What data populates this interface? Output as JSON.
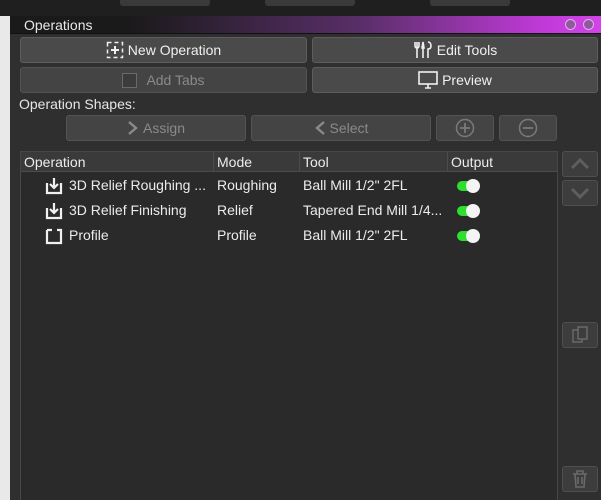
{
  "panel": {
    "title": "Operations"
  },
  "toolbar": {
    "new_operation": "New Operation",
    "edit_tools": "Edit Tools",
    "add_tabs": "Add Tabs",
    "preview": "Preview"
  },
  "shapes": {
    "label": "Operation Shapes:",
    "assign": "Assign",
    "select": "Select"
  },
  "table": {
    "headers": {
      "operation": "Operation",
      "mode": "Mode",
      "tool": "Tool",
      "output": "Output"
    },
    "rows": [
      {
        "operation": "3D Relief Roughing ...",
        "mode": "Roughing",
        "tool": "Ball Mill 1/2\" 2FL",
        "icon": "relief-icon",
        "output": true
      },
      {
        "operation": "3D Relief Finishing",
        "mode": "Relief",
        "tool": "Tapered End Mill 1/4...",
        "icon": "relief-icon",
        "output": true
      },
      {
        "operation": "Profile",
        "mode": "Profile",
        "tool": "Ball Mill 1/2\" 2FL",
        "icon": "profile-icon",
        "output": true
      }
    ]
  },
  "colors": {
    "toggle_on": "#2ee02e",
    "title_accent": "#d244e8"
  }
}
